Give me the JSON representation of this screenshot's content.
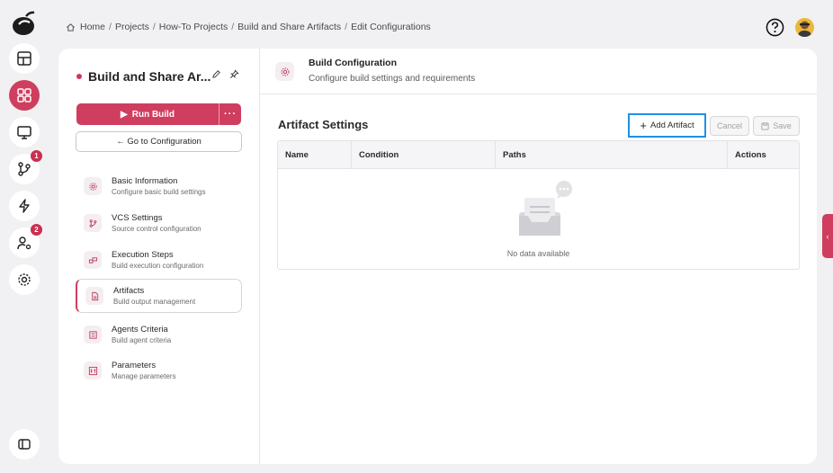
{
  "breadcrumb": [
    "Home",
    "Projects",
    "How-To Projects",
    "Build and Share Artifacts",
    "Edit Configurations"
  ],
  "rail": {
    "items": [
      {
        "icon": "dashboard-icon"
      },
      {
        "icon": "apps-grid-icon",
        "active": true
      },
      {
        "icon": "monitor-icon"
      },
      {
        "icon": "branch-merge-icon",
        "badge": "1"
      },
      {
        "icon": "lightning-icon"
      },
      {
        "icon": "user-settings-icon",
        "badge": "2"
      },
      {
        "icon": "gear-icon"
      }
    ]
  },
  "left": {
    "title": "Build and Share Ar...",
    "run_build": "Run Build",
    "more": "···",
    "goto_config": "← Go to Configuration",
    "nav": [
      {
        "label": "Basic Information",
        "sub": "Configure basic build settings",
        "icon": "gear-icon"
      },
      {
        "label": "VCS Settings",
        "sub": "Source control configuration",
        "icon": "branch-icon"
      },
      {
        "label": "Execution Steps",
        "sub": "Build execution configuration",
        "icon": "steps-icon"
      },
      {
        "label": "Artifacts",
        "sub": "Build output management",
        "icon": "file-icon",
        "selected": true
      },
      {
        "label": "Agents Criteria",
        "sub": "Build agent criteria",
        "icon": "agent-icon"
      },
      {
        "label": "Parameters",
        "sub": "Manage parameters",
        "icon": "parameters-icon"
      }
    ]
  },
  "right": {
    "header_title": "Build Configuration",
    "header_sub": "Configure build settings and requirements",
    "section_title": "Artifact Settings",
    "add_label": "Add Artifact",
    "cancel_label": "Cancel",
    "save_label": "Save",
    "columns": [
      "Name",
      "Condition",
      "Paths",
      "Actions"
    ],
    "empty_text": "No data available"
  },
  "colors": {
    "accent": "#cf3e5e",
    "focus": "#1e90e8"
  }
}
